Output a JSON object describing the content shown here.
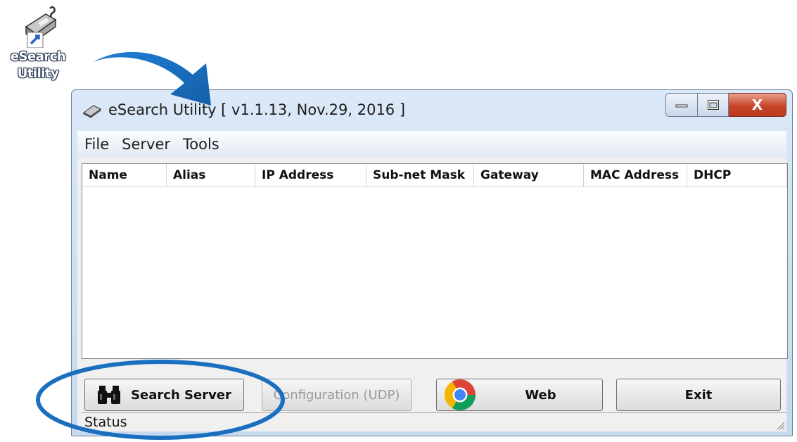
{
  "desktop": {
    "icon_name": "esearch-utility-icon",
    "label_lines": [
      "eSearch",
      "Utility"
    ]
  },
  "window": {
    "title": "eSearch Utility [ v1.1.13, Nov.29, 2016 ]",
    "caption_close_glyph": "X"
  },
  "menu": [
    "File",
    "Server",
    "Tools"
  ],
  "table": {
    "columns": [
      "Name",
      "Alias",
      "IP Address",
      "Sub-net Mask",
      "Gateway",
      "MAC Address",
      "DHCP"
    ],
    "rows": []
  },
  "buttons": {
    "search": "Search Server",
    "configuration": "Configuration (UDP)",
    "web": "Web",
    "exit": "Exit"
  },
  "status": {
    "text": "Status"
  },
  "annotation_colors": {
    "arrow": "#1a6fc0",
    "ellipse": "#1a6fc0"
  }
}
